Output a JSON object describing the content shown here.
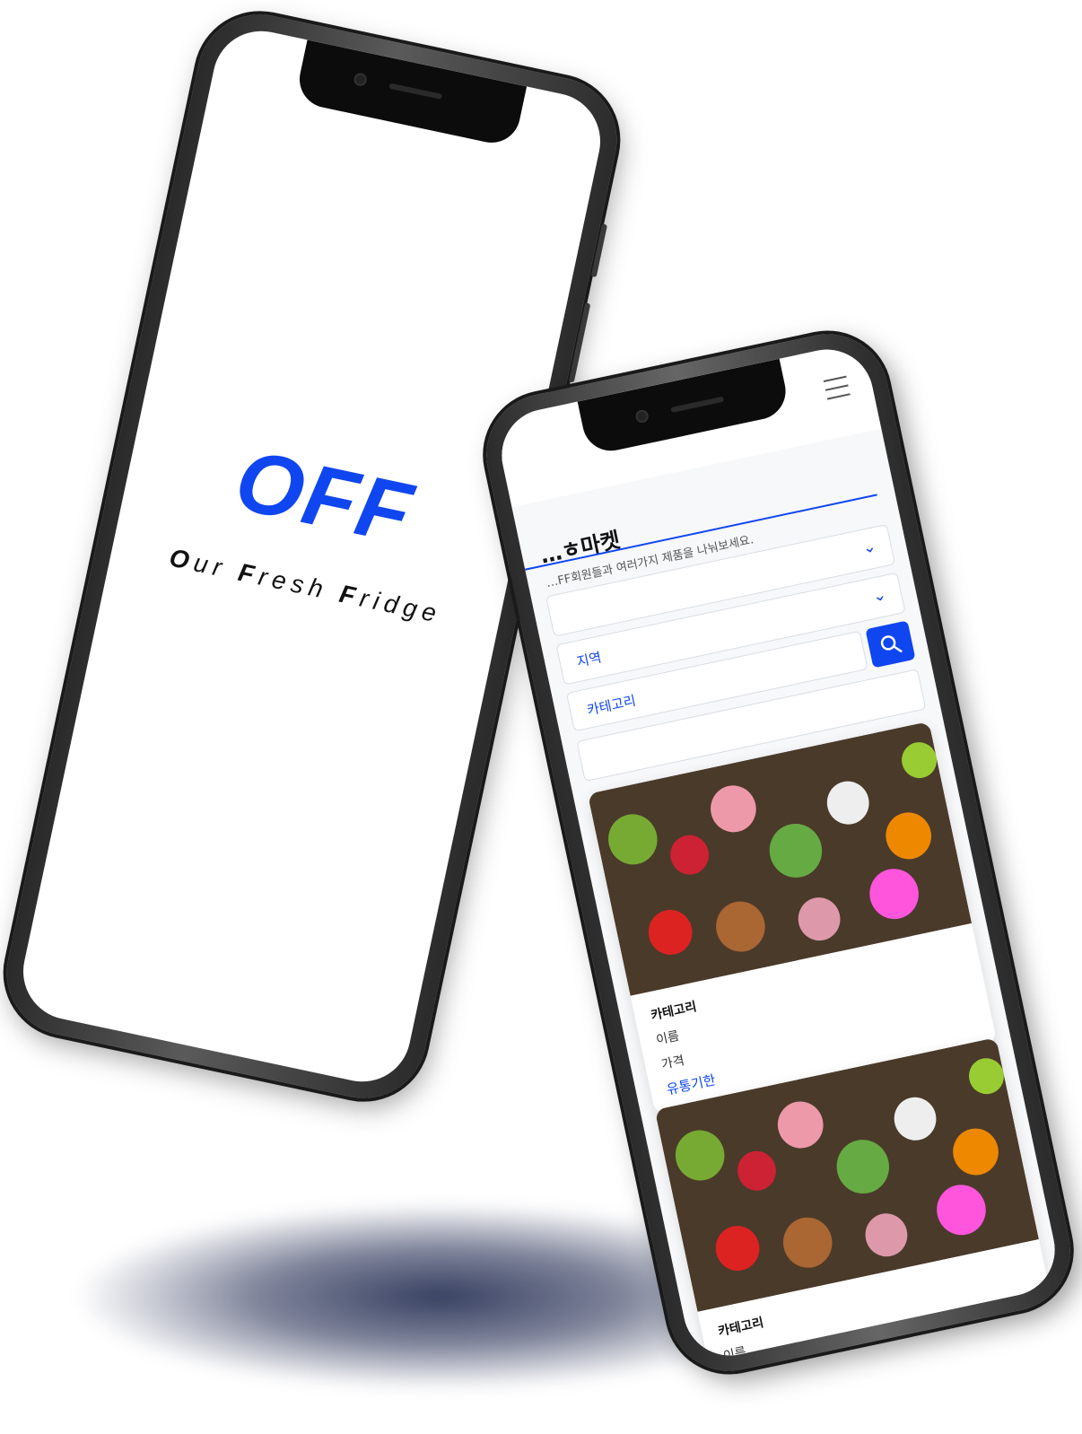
{
  "brand": {
    "logo": "OFF",
    "tagline_parts": [
      {
        "t": "O",
        "bold": true
      },
      {
        "t": "ur ",
        "bold": false
      },
      {
        "t": "F",
        "bold": true
      },
      {
        "t": "resh ",
        "bold": false
      },
      {
        "t": "F",
        "bold": true
      },
      {
        "t": "ridge",
        "bold": false
      }
    ]
  },
  "market": {
    "title": "…ㅎ마켓",
    "subtitle": "…FF회원들과 여러가지 제품을 나눠보세요.",
    "region_label": "지역",
    "category_label": "카테고리",
    "search": {
      "placeholder": ""
    },
    "cards": [
      {
        "category": "카테고리",
        "name": "이름",
        "price": "가격",
        "expiry": "유통기한"
      },
      {
        "category": "카테고리",
        "name": "이름",
        "price": "",
        "expiry": ""
      }
    ]
  },
  "icons": {
    "menu": "hamburger-icon",
    "search": "search-icon",
    "chevron": "chevron-down-icon"
  },
  "colors": {
    "accent": "#1046f0",
    "frame": "#2b2b2b"
  }
}
